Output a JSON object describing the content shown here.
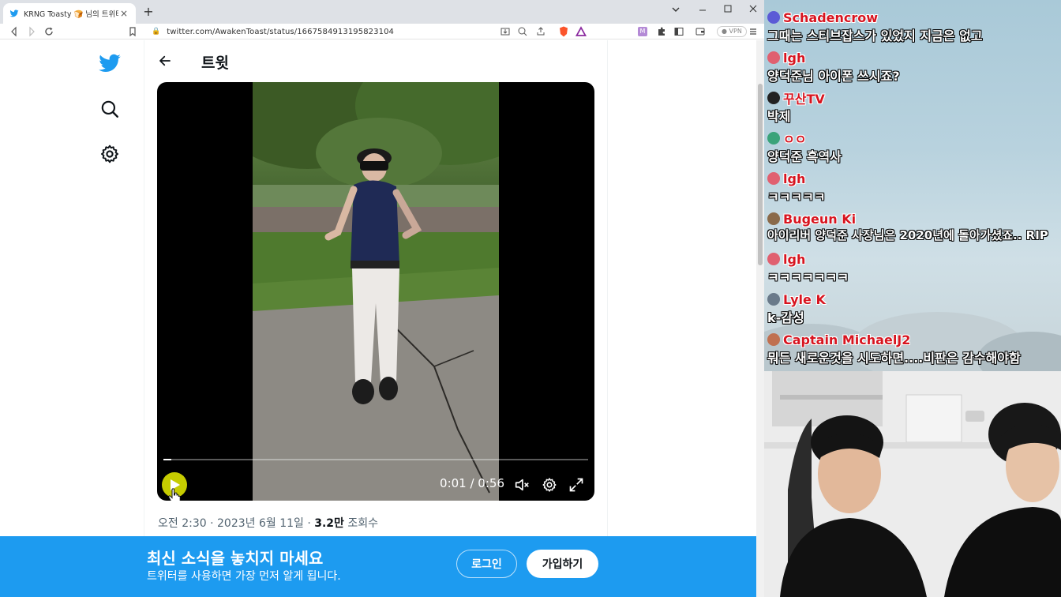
{
  "browser": {
    "tab_title": "KRNG Toasty 🍞 님의 트위터: \"Si",
    "tab_close": "×",
    "new_tab": "+",
    "url": "twitter.com/AwakenToast/status/1667584913195823104",
    "vpn_label": "● VPN"
  },
  "twitter": {
    "header_title": "트윗",
    "video": {
      "time": "0:01 / 0:56",
      "progress": 0.018
    },
    "meta": {
      "datetime": "오전 2:30 · 2023년 6월 11일 · ",
      "views_count": "3.2만",
      "views_label": " 조회수"
    },
    "banner": {
      "title": "최신 소식을 놓치지 마세요",
      "subtitle": "트위터를 사용하면 가장 먼저 알게 됩니다.",
      "login": "로그인",
      "signup": "가입하기"
    },
    "brand_color": "#1d9bf0"
  },
  "chat": {
    "messages": [
      {
        "user": "Schadencrow",
        "text": "그때는 스티브잡스가 있었지 지금은 없고",
        "avatar_color": "#5b5bd6"
      },
      {
        "user": "lgh",
        "text": "양덕준님 아이폰 쓰시죠?",
        "avatar_color": "#e06070"
      },
      {
        "user": "꾸산TV",
        "text": "박제",
        "avatar_color": "#222222"
      },
      {
        "user": "ㅇㅇ",
        "text": "양덕준 흑역사",
        "avatar_color": "#3aa37a"
      },
      {
        "user": "lgh",
        "text": "ㅋㅋㅋㅋㅋ",
        "avatar_color": "#e06070"
      },
      {
        "user": "Bugeun Ki",
        "text": "아이리버 양덕준 사장님은 2020년에 돌아가셨죠.. RIP",
        "avatar_color": "#8a6a4a"
      },
      {
        "user": "lgh",
        "text": "ㅋㅋㅋㅋㅋㅋㅋ",
        "avatar_color": "#e06070"
      },
      {
        "user": "Lyle K",
        "text": "k-감성",
        "avatar_color": "#6a7a8a"
      },
      {
        "user": "Captain MichaelJ2",
        "text": "뭐든 새로운것을 시도하면....비판은 감수해야함",
        "avatar_color": "#c07050"
      }
    ]
  }
}
